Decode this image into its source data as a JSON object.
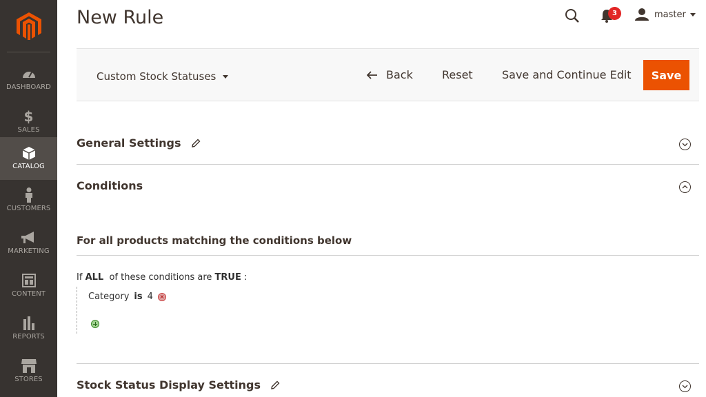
{
  "page": {
    "title": "New Rule"
  },
  "sidebar": {
    "items": [
      {
        "label": "DASHBOARD",
        "icon": "dashboard-icon"
      },
      {
        "label": "SALES",
        "icon": "dollar-icon"
      },
      {
        "label": "CATALOG",
        "icon": "box-icon",
        "active": true
      },
      {
        "label": "CUSTOMERS",
        "icon": "person-icon"
      },
      {
        "label": "MARKETING",
        "icon": "megaphone-icon"
      },
      {
        "label": "CONTENT",
        "icon": "layout-icon"
      },
      {
        "label": "REPORTS",
        "icon": "bar-chart-icon"
      },
      {
        "label": "STORES",
        "icon": "store-icon"
      }
    ]
  },
  "header": {
    "notifications_count": "3",
    "user_name": "master"
  },
  "toolbar": {
    "store_switcher": "Custom Stock Statuses",
    "back_label": "Back",
    "reset_label": "Reset",
    "save_continue_label": "Save and Continue Edit",
    "save_label": "Save"
  },
  "sections": {
    "general": "General Settings",
    "conditions": "Conditions",
    "stock_display": "Stock Status Display Settings"
  },
  "conditions": {
    "fieldset_title": "For all products matching the conditions below",
    "if_prefix": "If",
    "aggregator": "ALL",
    "middle_text": "of these conditions are",
    "value": "TRUE",
    "suffix": ":",
    "rule": {
      "attribute": "Category",
      "operator": "is",
      "value": "4"
    }
  },
  "colors": {
    "accent": "#eb5202",
    "sidebar_bg": "#373330",
    "badge": "#e22626"
  }
}
